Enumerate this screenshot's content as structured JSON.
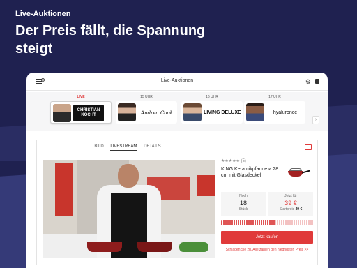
{
  "header": {
    "small": "Live-Auktionen",
    "headline": "Der Preis fällt, die Spannung steigt"
  },
  "app": {
    "title": "Live-Auktionen",
    "strip": [
      {
        "label": "LIVE",
        "brand": "CHRISTIAN KOCHT"
      },
      {
        "label": "15 UHR",
        "brand": "Andrea Cook"
      },
      {
        "label": "16 UHR",
        "brand": "LIVING DELUXE"
      },
      {
        "label": "17 UHR",
        "brand": "hyaluronce"
      }
    ],
    "tabs": [
      "BILD",
      "LIVESTREAM",
      "DETAILS"
    ],
    "active_tab": "LIVESTREAM"
  },
  "product": {
    "rating_count": "(5)",
    "stars": "★★★★★",
    "name": "KING Keramikpfanne ø 28 cm mit Glasdeckel",
    "stock_title": "Noch",
    "stock_count": "18",
    "stock_unit": "Stück",
    "now_title": "Jetzt für",
    "now_price": "39 €",
    "start_label": "Startpreis",
    "start_price": "49 €",
    "progress": 0.58,
    "buy_label": "Jetzt kaufen",
    "note": "Schlagen Sie zu. Alle zahlen den niedrigsten Preis >>"
  },
  "icons": [
    "menu-search-icon",
    "gear-icon",
    "bag-icon",
    "chevron-right-icon",
    "screen-icon"
  ],
  "colors": {
    "background": "#1f2150",
    "accent": "#e03a3a"
  }
}
